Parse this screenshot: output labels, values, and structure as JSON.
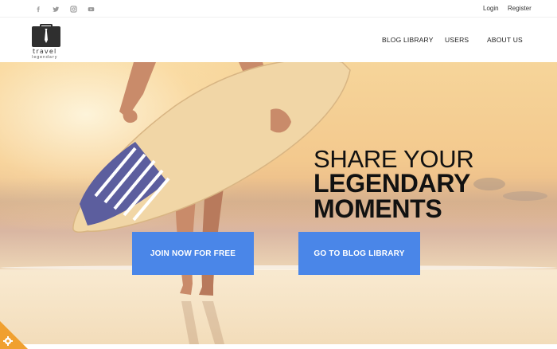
{
  "topbar": {
    "social": [
      {
        "icon": "facebook-icon",
        "glyph": "f"
      },
      {
        "icon": "twitter-icon",
        "glyph": "t"
      },
      {
        "icon": "instagram-icon",
        "glyph": "i"
      },
      {
        "icon": "youtube-icon",
        "glyph": "y"
      }
    ],
    "login_label": "Login",
    "register_label": "Register"
  },
  "header": {
    "logo_line1": "travel",
    "logo_line2": "legendary",
    "nav": [
      {
        "label": "BLOG LIBRARY"
      },
      {
        "label": "USERS"
      },
      {
        "label": "ABOUT US"
      }
    ]
  },
  "hero": {
    "headline_line1": "SHARE YOUR",
    "headline_line2": "LEGENDARY",
    "headline_line3": "MOMENTS",
    "cta_primary": "JOIN NOW FOR FREE",
    "cta_secondary": "GO TO BLOG LIBRARY"
  },
  "colors": {
    "accent": "#4a86e8",
    "settings_badge": "#f0a030"
  }
}
